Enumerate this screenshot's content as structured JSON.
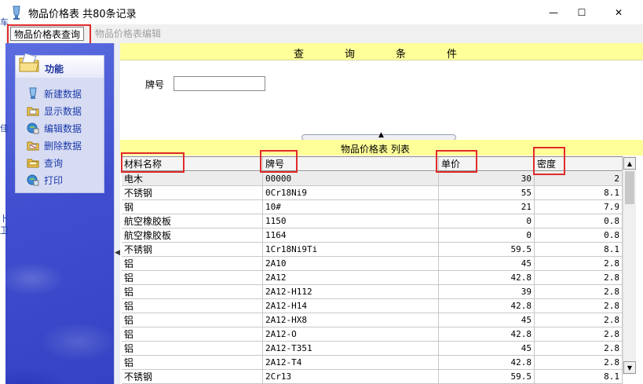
{
  "window": {
    "title": "物品价格表 共80条记录",
    "minimize_glyph": "—",
    "maximize_glyph": "☐",
    "close_glyph": "✕"
  },
  "tabs": [
    {
      "label": "物品价格表查询",
      "active": true
    },
    {
      "label": "物品价格表编辑",
      "active": false
    }
  ],
  "sidebar": {
    "header": "功能",
    "items": [
      {
        "label": "新建数据",
        "icon": "new-data-icon"
      },
      {
        "label": "显示数据",
        "icon": "display-data-icon"
      },
      {
        "label": "编辑数据",
        "icon": "edit-data-icon"
      },
      {
        "label": "删除数据",
        "icon": "delete-data-icon"
      },
      {
        "label": "查询",
        "icon": "query-icon"
      },
      {
        "label": "打印",
        "icon": "print-icon"
      }
    ]
  },
  "edge_glyphs": [
    "车",
    "佳",
    "卜",
    "卫"
  ],
  "query": {
    "header": "查询条件",
    "field_label": "牌号",
    "field_value": ""
  },
  "list": {
    "header": "物品价格表 列表",
    "columns": [
      "材料名称",
      "牌号",
      "单价",
      "密度"
    ],
    "rows": [
      [
        "电木",
        "00000",
        "30",
        "2"
      ],
      [
        "不锈钢",
        "0Cr18Ni9",
        "55",
        "8.1"
      ],
      [
        "钢",
        "10#",
        "21",
        "7.9"
      ],
      [
        "航空橡胶板",
        "1150",
        "0",
        "0.8"
      ],
      [
        "航空橡胶板",
        "1164",
        "0",
        "0.8"
      ],
      [
        "不锈钢",
        "1Cr18Ni9Ti",
        "59.5",
        "8.1"
      ],
      [
        "铝",
        "2A10",
        "45",
        "2.8"
      ],
      [
        "铝",
        "2A12",
        "42.8",
        "2.8"
      ],
      [
        "铝",
        "2A12-H112",
        "39",
        "2.8"
      ],
      [
        "铝",
        "2A12-H14",
        "42.8",
        "2.8"
      ],
      [
        "铝",
        "2A12-HX8",
        "45",
        "2.8"
      ],
      [
        "铝",
        "2A12-O",
        "42.8",
        "2.8"
      ],
      [
        "铝",
        "2A12-T351",
        "45",
        "2.8"
      ],
      [
        "铝",
        "2A12-T4",
        "42.8",
        "2.8"
      ],
      [
        "不锈钢",
        "2Cr13",
        "59.5",
        "8.1"
      ]
    ]
  },
  "colors": {
    "yellow_header": "#ffff99",
    "annotation_red": "#e02b2b",
    "sidebar_blue": "#3f4fcf",
    "link_blue": "#1c3aa9"
  }
}
